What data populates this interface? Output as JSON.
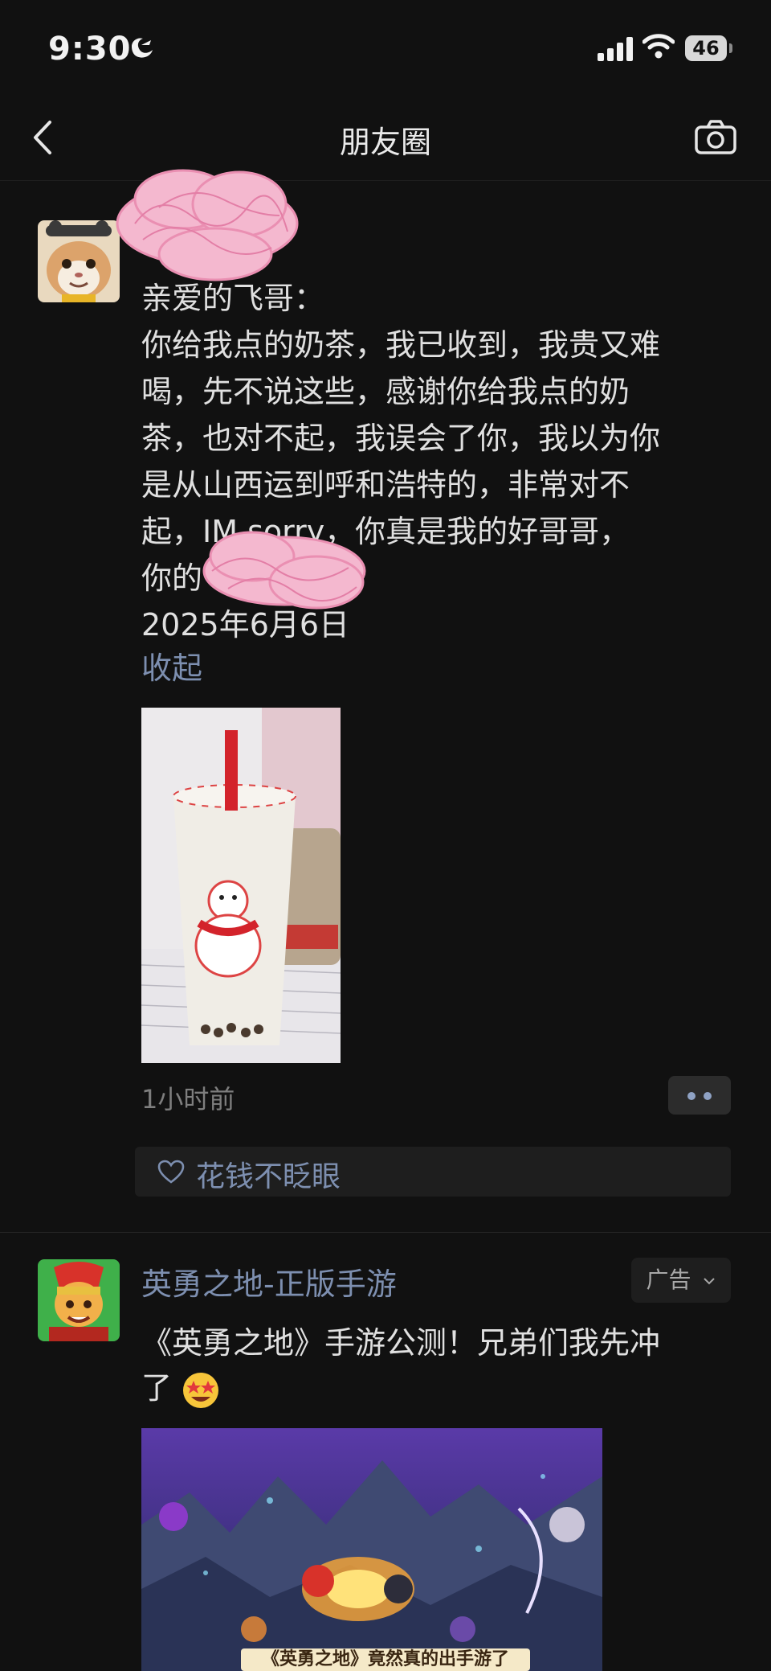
{
  "status_bar": {
    "time": "9:30",
    "battery": "46"
  },
  "nav": {
    "title": "朋友圈",
    "back_icon": "chevron-left-icon",
    "camera_icon": "camera-icon"
  },
  "post1": {
    "text_lines": [
      "亲爱的飞哥：",
      "你给我点的奶茶，我已收到，我贵又难",
      "喝，先不说这些，感谢你给我点的奶",
      "茶，也对不起，我误会了你，我以为你",
      "是从山西运到呼和浩特的，非常对不",
      "起，IM sorry，你真是我的好哥哥，",
      "你的",
      "2025年6月6日"
    ],
    "collapse_label": "收起",
    "time": "1小时前",
    "liker": "花钱不眨眼"
  },
  "ad": {
    "name": "英勇之地-正版手游",
    "tag": "广告",
    "text_line1": "《英勇之地》手游公测！兄弟们我先冲",
    "text_line2": "了",
    "caption": "《英勇之地》竟然真的出手游了"
  },
  "colors": {
    "background": "#111111",
    "link": "#7d8fb0",
    "text": "#e0e0e0"
  }
}
